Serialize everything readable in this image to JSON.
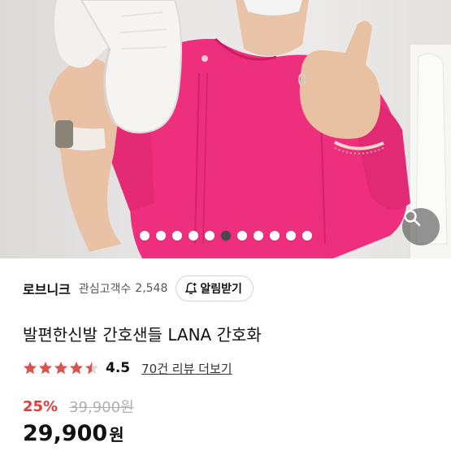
{
  "hero": {
    "image_count": 11,
    "active_index": 5,
    "zoom_icon": "magnifier-icon"
  },
  "seller": {
    "name": "로브니크",
    "favorite_label": "관심고객수",
    "favorite_count": "2,548",
    "alert_button_label": "알림받기",
    "alert_icon": "bell-plus-icon"
  },
  "product": {
    "title": "발편한신발 간호샌들 LANA 간호화"
  },
  "rating": {
    "value": "4.5",
    "stars": 4.5,
    "review_link": "70건 리뷰 더보기",
    "star_color": "#d9534f"
  },
  "price": {
    "discount": "25%",
    "original": "39,900원",
    "final_amount": "29,900",
    "final_unit": "원",
    "discount_color": "#e23b3b"
  }
}
